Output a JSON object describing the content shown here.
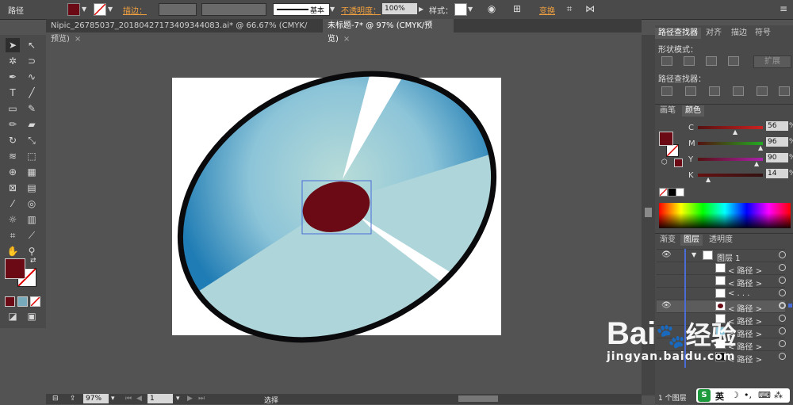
{
  "control_bar": {
    "object_label": "路径",
    "stroke_label": "描边：",
    "stroke_style": "基本",
    "opacity_label": "不透明度：",
    "opacity_value": "100%",
    "style_label": "样式：",
    "transform_label": "变换",
    "fill_color": "#6b0a14"
  },
  "tabs": [
    {
      "label": "Nipic_26785037_20180427173409344083.ai* @ 66.67% (CMYK/预览)",
      "close": "×"
    },
    {
      "label": "未标题-7* @ 97% (CMYK/预览)",
      "close": "×"
    }
  ],
  "toolbox": {
    "icons": [
      "selection-arrow-icon",
      "direct-selection-icon",
      "magic-wand-icon",
      "lasso-icon",
      "pen-icon",
      "curvature-icon",
      "type-icon",
      "line-icon",
      "rectangle-icon",
      "paintbrush-icon",
      "pencil-icon",
      "eraser-icon",
      "rotate-icon",
      "scale-icon",
      "warp-icon",
      "free-transform-icon",
      "shape-builder-icon",
      "perspective-icon",
      "mesh-icon",
      "gradient-icon",
      "eyedropper-icon",
      "blend-icon",
      "symbol-sprayer-icon",
      "graph-icon",
      "artboard-icon",
      "slice-icon",
      "hand-icon",
      "zoom-icon"
    ],
    "fill_color": "#6b0a14"
  },
  "pathfinder_panel": {
    "tabs": [
      "路径查找器",
      "对齐",
      "描边",
      "符号"
    ],
    "shape_modes_label": "形状模式：",
    "expand_button": "扩展",
    "pathfinders_label": "路径查找器："
  },
  "color_panel": {
    "tabs": [
      "画笔",
      "颜色"
    ],
    "channels": [
      {
        "name": "C",
        "value": "56",
        "unit": "%",
        "fraction": 0.56,
        "color": "#c22"
      },
      {
        "name": "M",
        "value": "96",
        "unit": "%",
        "fraction": 0.96,
        "color": "#2a2"
      },
      {
        "name": "Y",
        "value": "90",
        "unit": "%",
        "fraction": 0.9,
        "color": "#a2a"
      },
      {
        "name": "K",
        "value": "14",
        "unit": "%",
        "fraction": 0.14,
        "color": "#c22"
      }
    ]
  },
  "layers_panel": {
    "tabs": [
      "渐变",
      "图层",
      "透明度"
    ],
    "layer_name": "图层 1",
    "items": [
      "< 路径 >",
      "< 路径 >",
      "< . . .",
      "< 路径 >",
      "< 路径 >",
      "< 路径 >",
      "< 路径 >",
      "< 路径 >"
    ],
    "footer": "1 个图层"
  },
  "status_bar": {
    "zoom": "97%",
    "page": "1",
    "tool": "选择"
  },
  "watermark": {
    "brand": "Bai",
    "brand2": "经验",
    "url": "jingyan.baidu.com"
  },
  "ime": {
    "label": "英"
  }
}
